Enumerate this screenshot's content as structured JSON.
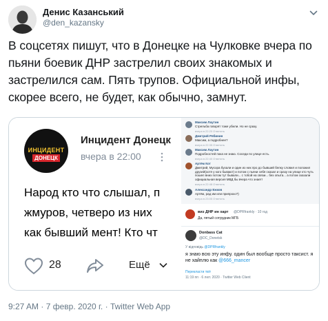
{
  "author": {
    "name": "Денис Казанський",
    "handle": "@den_kazansky"
  },
  "tweet": {
    "text": "В соцсетях пишут, что в Донецке на Чулковке вчера по пьяни боевик ДНР застрелил своих знакомых и застрелился сам. Пять трупов. Официальной инфы, скорее всего, не будет, как обычно, замнут."
  },
  "media": {
    "vk_post": {
      "logo_line1": "ИНЦИДЕНТ",
      "logo_line2": "ДОНЕЦК",
      "title": "Инцидент Донецк",
      "time": "вчера в 22:00",
      "body_lines": [
        "Народ кто что слышал, п",
        "жмуров, четверо из них",
        "как бывший мент! Кто чт"
      ],
      "likes": "28",
      "more_label": "Ещё"
    },
    "comments": [
      {
        "name": "Максим Лаутин",
        "text": "Стрельба говорят тоже убили. Но не сразу.",
        "meta": "вчера в 22:20  Ответить"
      },
      {
        "name": "Дмитрий Рябинин",
        "text": "Максим, а подробнее?",
        "meta": "вчера в 22:35  Ответить"
      },
      {
        "name": "Максим Лаутин",
        "text": "Подробностей пока не знаю. Соседи по улице есть.",
        "meta": "вчера в 22:40  Ответить"
      },
      {
        "name": "Артём Кот",
        "text": "Дмитрий, Мусора бухали и один из них про до бывший белку словил и положил друзей(хотя у кого бывают) и потом с пьяни себя сказал и сразу на улице кто чуть пошел вниз потом тут бывали... с тобой на связи... без опыта... а потом сказали официальная версия МВД бы вчера что знает!",
        "meta": "вчера в 22:48  Ответить"
      },
      {
        "name": "Александр Ежков",
        "text": "Артём, рад им или припрохо?)",
        "meta": "вчера в 23:05  Ответить"
      }
    ],
    "telegram": {
      "top_name": "виз ДНР ин харт",
      "top_handle": "@DPRfrankly · 10 год",
      "top_text": "Да, пятый сотрудник МГБ",
      "author_name": "Donbass Cat",
      "author_handle": "@DC_Donetsk",
      "reply_prefix": "У відповідь",
      "reply_handle": "@DPRfrankly",
      "message_part1": "я знаю всю эту инфу. один был вообще просто таксист. я не хайплю как ",
      "message_mention": "@666_mancer",
      "translate": "Перекласти твіт",
      "meta": "11:19 пп · 6 лют. 2020 · Twitter Web Client"
    }
  },
  "footer": {
    "time": "9:27 AM",
    "date": "7 февр. 2020 г.",
    "source": "Twitter Web App"
  }
}
